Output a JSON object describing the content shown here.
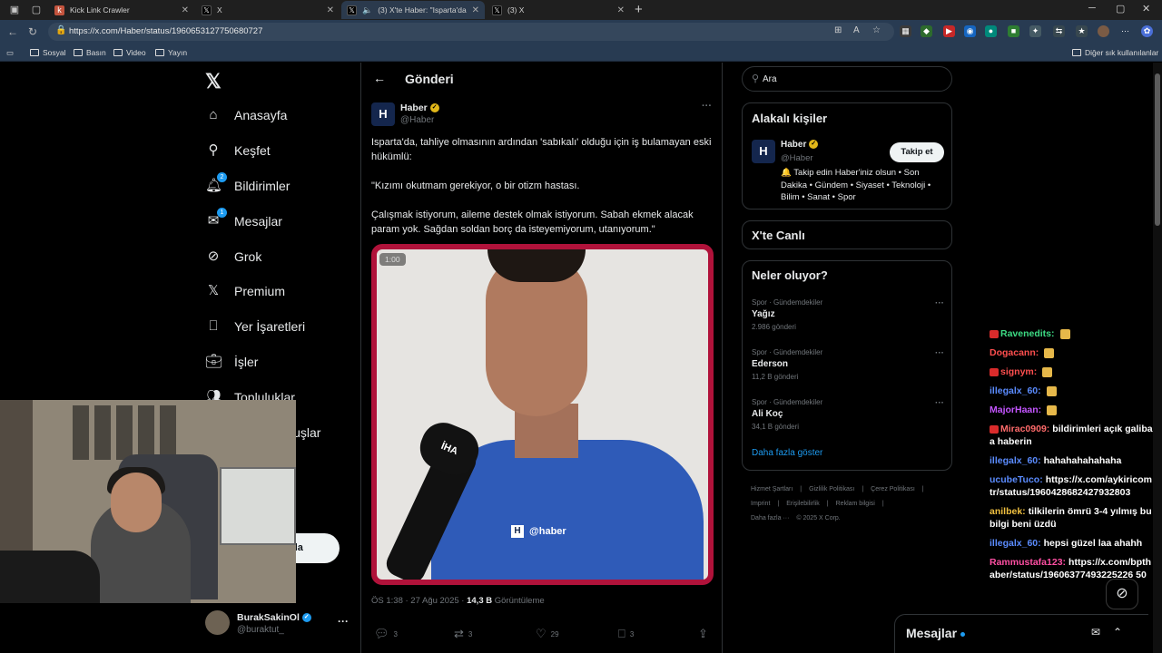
{
  "browser": {
    "tabs": [
      {
        "title": "Kick Link Crawler",
        "favicon": "kick-icon"
      },
      {
        "title": "X",
        "favicon": "x-icon"
      },
      {
        "title": "(3) X'te Haber: \"Isparta'da, ta",
        "favicon": "x-icon",
        "active": true
      },
      {
        "title": "(3) X",
        "favicon": "x-icon"
      }
    ],
    "url": "https://x.com/Haber/status/1960653127750680727",
    "bookmarks": [
      "Sosyal",
      "Basın",
      "Video",
      "Yayın"
    ],
    "other_bookmarks": "Diğer sık kullanılanlar"
  },
  "sidebar": {
    "items": [
      {
        "label": "Anasayfa",
        "icon": "home-icon"
      },
      {
        "label": "Keşfet",
        "icon": "search-icon"
      },
      {
        "label": "Bildirimler",
        "icon": "bell-icon",
        "badge": "2"
      },
      {
        "label": "Mesajlar",
        "icon": "mail-icon",
        "badge": "1"
      },
      {
        "label": "Grok",
        "icon": "grok-icon"
      },
      {
        "label": "Premium",
        "icon": "x-logo-icon"
      },
      {
        "label": "Yer İşaretleri",
        "icon": "bookmark-icon"
      },
      {
        "label": "İşler",
        "icon": "briefcase-icon"
      },
      {
        "label": "Topluluklar",
        "icon": "people-icon"
      },
      {
        "label": "luşlar",
        "icon": "org-icon"
      }
    ],
    "post_button": "nla",
    "account": {
      "name": "BurakSakinOl",
      "handle": "@buraktut_"
    }
  },
  "post": {
    "header_title": "Gönderi",
    "author_name": "Haber",
    "author_handle": "@Haber",
    "paragraphs": [
      "Isparta'da, tahliye olmasının ardından 'sabıkalı' olduğu için iş bulamayan eski hükümlü:",
      "\"Kızımı okutmam gerekiyor, o bir otizm hastası.",
      "Çalışmak istiyorum, aileme destek olmak istiyorum. Sabah ekmek alacak param yok. Sağdan soldan borç da isteyemiyorum, utanıyorum.\""
    ],
    "video": {
      "duration": "1:00",
      "watermark": "@haber",
      "mic_label": "İHA"
    },
    "timestamp": "ÖS 1:38 · 27 Ağu 2025 · ",
    "views_value": "14,3 B",
    "views_label": " Görüntüleme",
    "actions": {
      "replies": "3",
      "reposts": "3",
      "likes": "29",
      "bookmarks": "3"
    }
  },
  "right": {
    "search_placeholder": "Ara",
    "related_title": "Alakalı kişiler",
    "related": {
      "name": "Haber",
      "handle": "@Haber",
      "follow_label": "Takip et",
      "bio": "🔔 Takip edin Haber'iniz olsun • Son Dakika • Gündem • Siyaset • Teknoloji • Bilim • Sanat • Spor"
    },
    "live_title": "X'te Canlı",
    "trends_title": "Neler oluyor?",
    "trends": [
      {
        "category": "Spor · Gündemdekiler",
        "name": "Yağız",
        "count": "2.986 gönderi"
      },
      {
        "category": "Spor · Gündemdekiler",
        "name": "Ederson",
        "count": "11,2 B gönderi"
      },
      {
        "category": "Spor · Gündemdekiler",
        "name": "Ali Koç",
        "count": "34,1 B gönderi"
      }
    ],
    "show_more": "Daha fazla göster",
    "footer_links": [
      "Hizmet Şartları",
      "|",
      "Gizlilik Politikası",
      "|",
      "Çerez Politikası",
      "|",
      "Imprint",
      "|",
      "Erişilebilirlik",
      "|",
      "Reklam bilgisi",
      "|",
      "Daha fazla ···",
      "© 2025 X Corp."
    ]
  },
  "chat": [
    {
      "user": "Ravenedits:",
      "color": "#3ddc84",
      "message": "",
      "emote": true,
      "mod": true
    },
    {
      "user": "Dogacann:",
      "color": "#ff4f4f",
      "message": "",
      "emote": true
    },
    {
      "user": "signym:",
      "color": "#ff4f4f",
      "message": "",
      "emote": true,
      "mod": true
    },
    {
      "user": "illegalx_60:",
      "color": "#5b8cff",
      "message": "",
      "emote": true
    },
    {
      "user": "MajorHaan:",
      "color": "#c455ff",
      "message": "",
      "emote": true
    },
    {
      "user": "Mirac0909:",
      "color": "#ff6b6b",
      "message": "bildirimleri açık galiba a haberin",
      "mod": true
    },
    {
      "user": "illegalx_60:",
      "color": "#5b8cff",
      "message": "hahahahahahaha"
    },
    {
      "user": "ucubeTuco:",
      "color": "#5b8cff",
      "message": "https://x.com/aykiricomtr/status/1960428682427932803"
    },
    {
      "user": "anilbek:",
      "color": "#f0c040",
      "message": "tilkilerin ömrü 3-4 yılmış bu bilgi beni üzdü"
    },
    {
      "user": "illegalx_60:",
      "color": "#5b8cff",
      "message": "hepsi güzel laa ahahh"
    },
    {
      "user": "Rammustafa123:",
      "color": "#ff4fa3",
      "message": "https://x.com/bpthaber/status/19606377493225226 50"
    }
  ],
  "messages_dock": {
    "title": "Mesajlar"
  }
}
